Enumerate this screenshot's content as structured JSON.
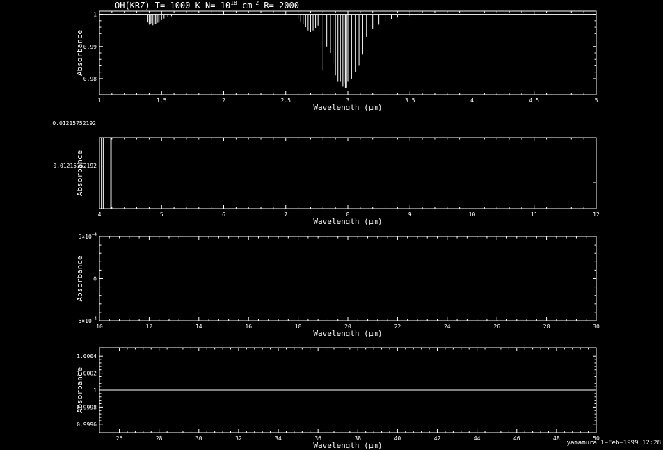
{
  "figure": {
    "title_prefix": "OH(KRZ) T= 1000 K N= 10",
    "title_exp": "18",
    "title_mid": " cm",
    "title_exp2": "−2",
    "title_suffix": " R= 2000",
    "footer": "yamamura  1−Feb−1999 12:28",
    "foreground": "#ffffff",
    "background": "#000000"
  },
  "chart_data": [
    {
      "type": "line",
      "xlabel": "Wavelength (μm)",
      "ylabel": "Absorbance",
      "xlim": [
        1,
        5
      ],
      "ylim": [
        0.975,
        1.001
      ],
      "xticks": [
        1,
        1.5,
        2,
        2.5,
        3,
        3.5,
        4,
        4.5,
        5
      ],
      "xtick_labels": [
        "1",
        "1.5",
        "2",
        "2.5",
        "3",
        "3.5",
        "4",
        "4.5",
        "5"
      ],
      "yticks": [
        1,
        0.99,
        0.98
      ],
      "ytick_labels": [
        "1",
        "0.99",
        "0.98"
      ],
      "baseline": 1,
      "absorption_lines": [
        {
          "x": 1.39,
          "y": 0.9975
        },
        {
          "x": 1.4,
          "y": 0.9968
        },
        {
          "x": 1.41,
          "y": 0.997
        },
        {
          "x": 1.42,
          "y": 0.9972
        },
        {
          "x": 1.43,
          "y": 0.9966
        },
        {
          "x": 1.44,
          "y": 0.9965
        },
        {
          "x": 1.45,
          "y": 0.9969
        },
        {
          "x": 1.46,
          "y": 0.9971
        },
        {
          "x": 1.47,
          "y": 0.9974
        },
        {
          "x": 1.48,
          "y": 0.9977
        },
        {
          "x": 1.5,
          "y": 0.9982
        },
        {
          "x": 1.52,
          "y": 0.9987
        },
        {
          "x": 1.55,
          "y": 0.9991
        },
        {
          "x": 1.58,
          "y": 0.9994
        },
        {
          "x": 2.6,
          "y": 0.9985
        },
        {
          "x": 2.62,
          "y": 0.9978
        },
        {
          "x": 2.64,
          "y": 0.997
        },
        {
          "x": 2.66,
          "y": 0.996
        },
        {
          "x": 2.68,
          "y": 0.995
        },
        {
          "x": 2.7,
          "y": 0.9945
        },
        {
          "x": 2.72,
          "y": 0.995
        },
        {
          "x": 2.74,
          "y": 0.9958
        },
        {
          "x": 2.76,
          "y": 0.9965
        },
        {
          "x": 2.8,
          "y": 0.9825
        },
        {
          "x": 2.83,
          "y": 0.99
        },
        {
          "x": 2.86,
          "y": 0.988
        },
        {
          "x": 2.88,
          "y": 0.985
        },
        {
          "x": 2.9,
          "y": 0.981
        },
        {
          "x": 2.92,
          "y": 0.979
        },
        {
          "x": 2.94,
          "y": 0.979
        },
        {
          "x": 2.96,
          "y": 0.9775
        },
        {
          "x": 2.97,
          "y": 0.9785
        },
        {
          "x": 2.98,
          "y": 0.977
        },
        {
          "x": 2.99,
          "y": 0.9772
        },
        {
          "x": 3.0,
          "y": 0.979
        },
        {
          "x": 3.03,
          "y": 0.98
        },
        {
          "x": 3.06,
          "y": 0.982
        },
        {
          "x": 3.09,
          "y": 0.984
        },
        {
          "x": 3.12,
          "y": 0.9875
        },
        {
          "x": 3.15,
          "y": 0.993
        },
        {
          "x": 3.2,
          "y": 0.9955
        },
        {
          "x": 3.25,
          "y": 0.9968
        },
        {
          "x": 3.3,
          "y": 0.9978
        },
        {
          "x": 3.35,
          "y": 0.9985
        },
        {
          "x": 3.4,
          "y": 0.999
        },
        {
          "x": 3.5,
          "y": 0.9994
        }
      ]
    },
    {
      "type": "line",
      "xlabel": "Wavelength (μm)",
      "ylabel": "Absorbance",
      "xlim": [
        4,
        12
      ],
      "ylim": [
        0,
        1
      ],
      "xticks": [
        4,
        5,
        6,
        7,
        8,
        9,
        10,
        11,
        12
      ],
      "xtick_labels": [
        "4",
        "5",
        "6",
        "7",
        "8",
        "9",
        "10",
        "11",
        "12"
      ],
      "ytick_labels": [
        "0.01215752192",
        "0.01215752192"
      ],
      "absorption_lines": [
        {
          "x": 4.03,
          "y": 0
        },
        {
          "x": 4.06,
          "y": 0
        },
        {
          "x": 4.18,
          "y": 0
        },
        {
          "x": 4.19,
          "y": 0
        }
      ]
    },
    {
      "type": "line",
      "xlabel": "Wavelength (μm)",
      "ylabel": "Absorbance",
      "xlim": [
        10,
        30
      ],
      "ylim": [
        -0.0005,
        0.0005
      ],
      "xticks": [
        10,
        12,
        14,
        16,
        18,
        20,
        22,
        24,
        26,
        28,
        30
      ],
      "xtick_labels": [
        "10",
        "12",
        "14",
        "16",
        "18",
        "20",
        "22",
        "24",
        "26",
        "28",
        "30"
      ],
      "yticks": [
        0.0005,
        0,
        -0.0005
      ],
      "ytick_labels": [
        "5×10",
        "0",
        "−5×10"
      ],
      "ytick_exps": [
        "−4",
        "",
        "−4"
      ]
    },
    {
      "type": "line",
      "xlabel": "Wavelength (μm)",
      "ylabel": "Absorbance",
      "xlim": [
        25,
        50
      ],
      "ylim": [
        0.9995,
        1.0005
      ],
      "xticks": [
        26,
        28,
        30,
        32,
        34,
        36,
        38,
        40,
        42,
        44,
        46,
        48,
        50
      ],
      "xtick_labels": [
        "26",
        "28",
        "30",
        "32",
        "34",
        "36",
        "38",
        "40",
        "42",
        "44",
        "46",
        "48",
        "50"
      ],
      "yticks": [
        1.0004,
        1.0002,
        1,
        0.9998,
        0.9996
      ],
      "ytick_labels": [
        "1.0004",
        "1.0002",
        "1",
        "0.9998",
        "0.9996"
      ],
      "baseline": 1
    }
  ]
}
